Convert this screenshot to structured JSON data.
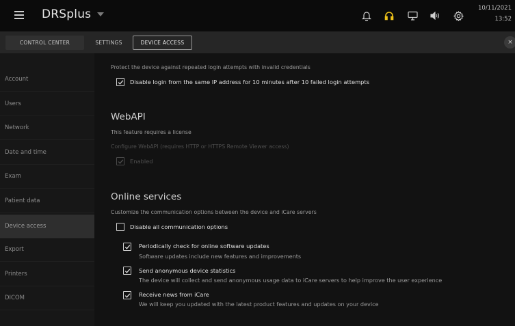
{
  "header": {
    "brand": "DRSplus",
    "date": "10/11/2021",
    "time": "13:52",
    "icons": [
      "bell-icon",
      "headset-icon",
      "monitor-icon",
      "volume-icon",
      "gear-icon"
    ],
    "accent_color": "#f0c419"
  },
  "tabs": {
    "control_center": "CONTROL CENTER",
    "settings": "SETTINGS",
    "device_access": "DEVICE ACCESS",
    "close": "×"
  },
  "sidebar": {
    "items": [
      {
        "label": "Account"
      },
      {
        "label": "Users"
      },
      {
        "label": "Network"
      },
      {
        "label": "Date and time"
      },
      {
        "label": "Exam"
      },
      {
        "label": "Patient data"
      },
      {
        "label": "Device access"
      },
      {
        "label": "Export"
      },
      {
        "label": "Printers"
      },
      {
        "label": "DICOM"
      }
    ],
    "active": "Device access"
  },
  "login_protection": {
    "description": "Protect the device against repeated login attempts with invalid credentials",
    "option": "Disable login from the same IP address for 10 minutes after 10 failed login attempts",
    "checked": true
  },
  "webapi": {
    "title": "WebAPI",
    "license_note": "This feature requires a license",
    "configure_note": "Configure WebAPI (requires HTTP or HTTPS Remote Viewer access)",
    "enabled_label": "Enabled",
    "enabled_checked": true
  },
  "online_services": {
    "title": "Online services",
    "description": "Customize the communication options between the device and iCare servers",
    "disable_all": {
      "label": "Disable all communication options",
      "checked": false
    },
    "options": [
      {
        "label": "Periodically check for online software updates",
        "sub": "Software updates include new features and improvements",
        "checked": true
      },
      {
        "label": "Send anonymous device statistics",
        "sub": "The device will collect and send anonymous usage data to iCare servers to help improve the user experience",
        "checked": true
      },
      {
        "label": "Receive news from iCare",
        "sub": "We will keep you updated with the latest product features and updates on your device",
        "checked": true
      }
    ]
  }
}
